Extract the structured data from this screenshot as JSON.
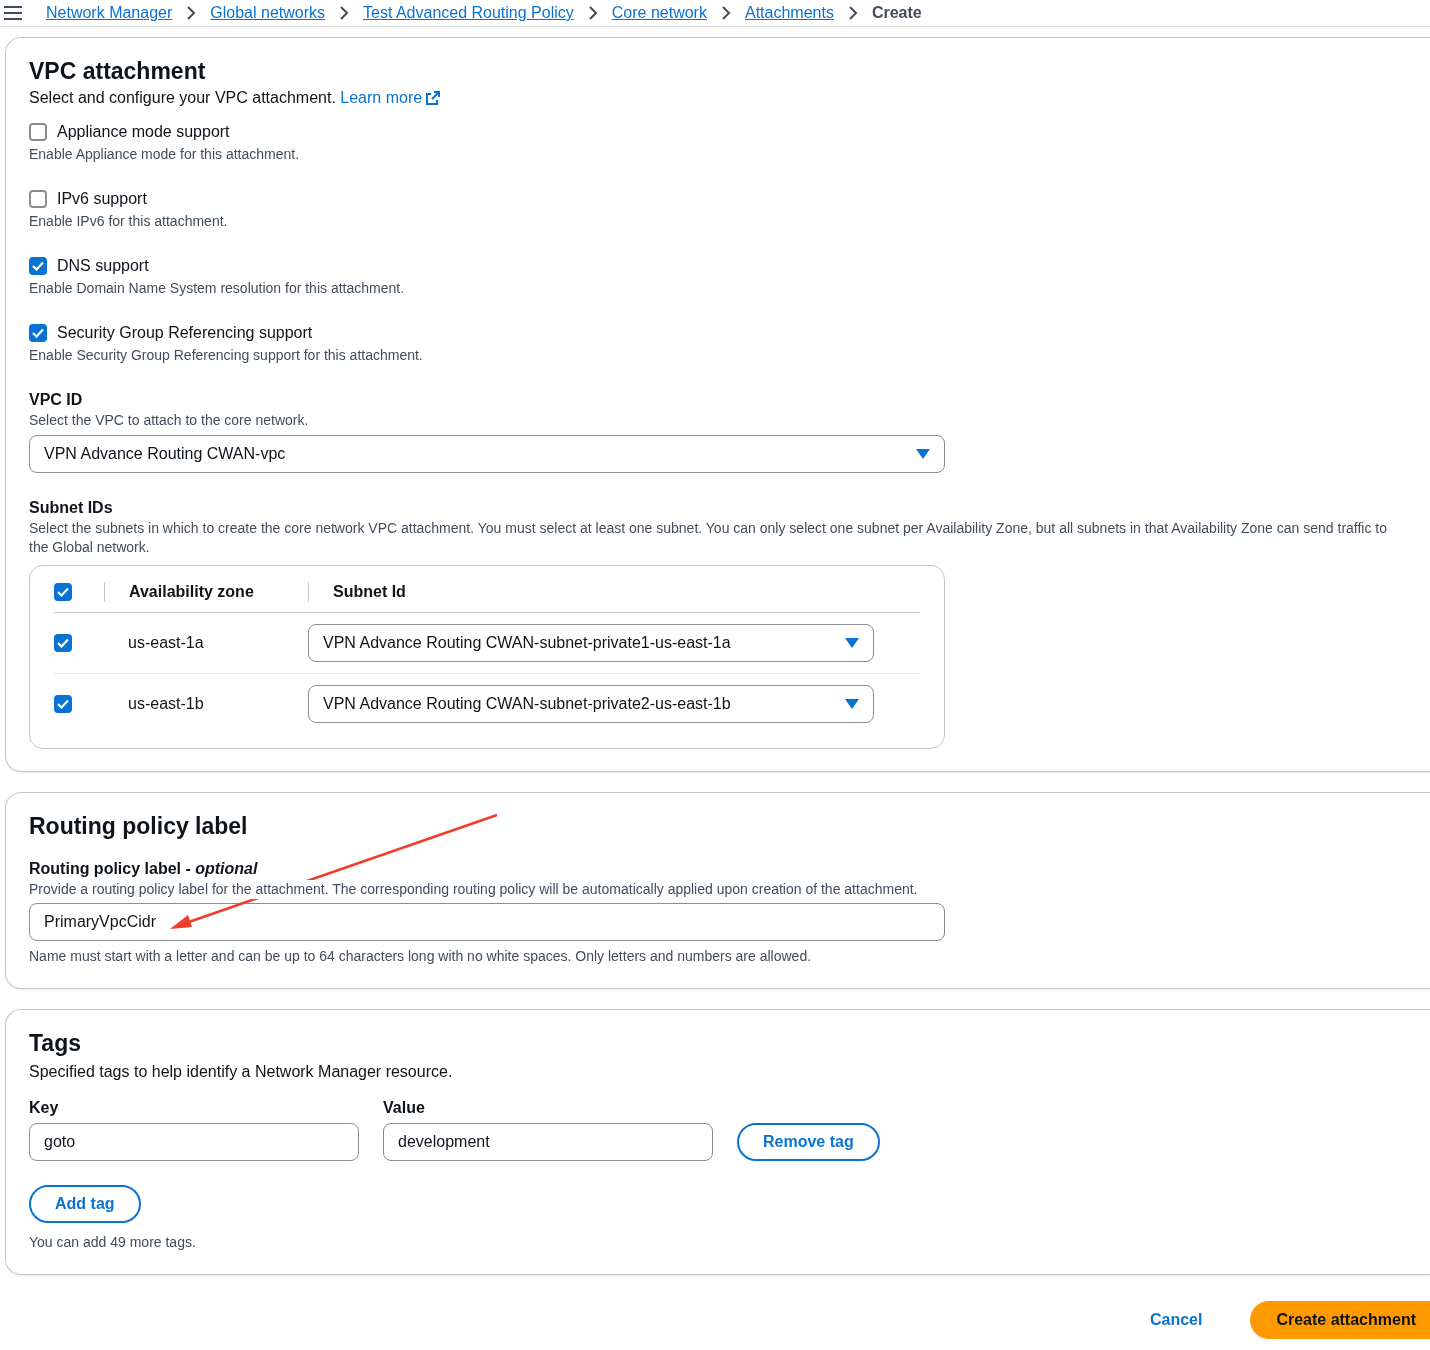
{
  "breadcrumbs": [
    {
      "label": "Network Manager",
      "link": true
    },
    {
      "label": "Global networks",
      "link": true
    },
    {
      "label": "Test Advanced Routing Policy",
      "link": true
    },
    {
      "label": "Core network",
      "link": true
    },
    {
      "label": "Attachments",
      "link": true
    },
    {
      "label": "Create",
      "link": false
    }
  ],
  "vpc_attachment": {
    "title": "VPC attachment",
    "description": "Select and configure your VPC attachment.",
    "learn_more": "Learn more",
    "options": [
      {
        "label": "Appliance mode support",
        "description": "Enable Appliance mode for this attachment.",
        "checked": false
      },
      {
        "label": "IPv6 support",
        "description": "Enable IPv6 for this attachment.",
        "checked": false
      },
      {
        "label": "DNS support",
        "description": "Enable Domain Name System resolution for this attachment.",
        "checked": true
      },
      {
        "label": "Security Group Referencing support",
        "description": "Enable Security Group Referencing support for this attachment.",
        "checked": true
      }
    ],
    "vpc_id": {
      "label": "VPC ID",
      "description": "Select the VPC to attach to the core network.",
      "value": "VPN Advance Routing CWAN-vpc"
    },
    "subnet_ids": {
      "label": "Subnet IDs",
      "description": "Select the subnets in which to create the core network VPC attachment. You must select at least one subnet. You can only select one subnet per Availability Zone, but all subnets in that Availability Zone can send traffic to the Global network.",
      "all_checked": true,
      "columns": [
        "Availability zone",
        "Subnet Id"
      ],
      "rows": [
        {
          "zone": "us-east-1a",
          "subnet": "VPN Advance Routing CWAN-subnet-private1-us-east-1a",
          "checked": true
        },
        {
          "zone": "us-east-1b",
          "subnet": "VPN Advance Routing CWAN-subnet-private2-us-east-1b",
          "checked": true
        }
      ]
    }
  },
  "routing_policy": {
    "title": "Routing policy label",
    "field_label": "Routing policy label - *optional*",
    "description": "Provide a routing policy label for the attachment. The corresponding routing policy will be automatically applied upon creation of the attachment.",
    "value": "PrimaryVpcCidr",
    "constraint": "Name must start with a letter and can be up to 64 characters long with no white spaces. Only letters and numbers are allowed."
  },
  "tags": {
    "title": "Tags",
    "description": "Specified tags to help identify a Network Manager resource.",
    "key_label": "Key",
    "value_label": "Value",
    "items": [
      {
        "key": "goto",
        "value": "development",
        "remove": "Remove tag"
      }
    ],
    "add": "Add tag",
    "hint": "You can add 49 more tags."
  },
  "actions": {
    "cancel": "Cancel",
    "create": "Create attachment"
  }
}
